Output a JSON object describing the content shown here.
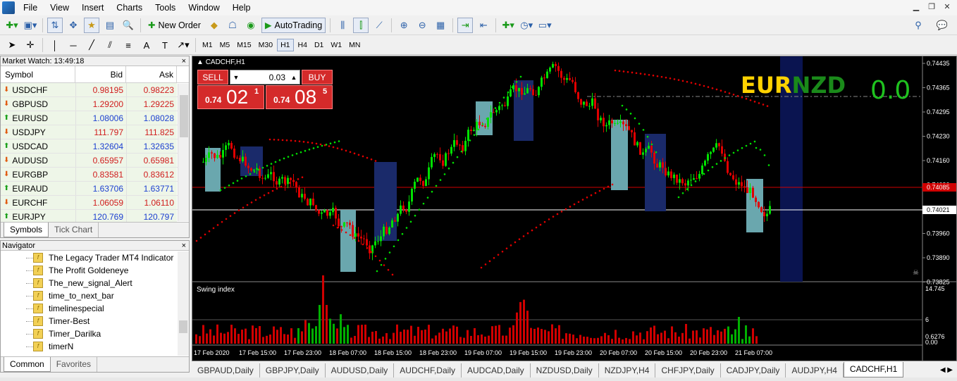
{
  "menu": [
    "File",
    "View",
    "Insert",
    "Charts",
    "Tools",
    "Window",
    "Help"
  ],
  "toolbar": {
    "new_order": "New Order",
    "auto_trading": "AutoTrading"
  },
  "timeframes": [
    "M1",
    "M5",
    "M15",
    "M30",
    "H1",
    "H4",
    "D1",
    "W1",
    "MN"
  ],
  "active_timeframe": "H1",
  "market_watch": {
    "title": "Market Watch: 13:49:18",
    "columns": [
      "Symbol",
      "Bid",
      "Ask"
    ],
    "rows": [
      {
        "symbol": "USDCHF",
        "bid": "0.98195",
        "ask": "0.98223",
        "dir": "down",
        "color": "#d01c1c"
      },
      {
        "symbol": "GBPUSD",
        "bid": "1.29200",
        "ask": "1.29225",
        "dir": "down",
        "color": "#d01c1c"
      },
      {
        "symbol": "EURUSD",
        "bid": "1.08006",
        "ask": "1.08028",
        "dir": "up",
        "color": "#1c3fd0"
      },
      {
        "symbol": "USDJPY",
        "bid": "111.797",
        "ask": "111.825",
        "dir": "down",
        "color": "#d01c1c"
      },
      {
        "symbol": "USDCAD",
        "bid": "1.32604",
        "ask": "1.32635",
        "dir": "up",
        "color": "#1c3fd0"
      },
      {
        "symbol": "AUDUSD",
        "bid": "0.65957",
        "ask": "0.65981",
        "dir": "down",
        "color": "#d01c1c"
      },
      {
        "symbol": "EURGBP",
        "bid": "0.83581",
        "ask": "0.83612",
        "dir": "down",
        "color": "#d01c1c"
      },
      {
        "symbol": "EURAUD",
        "bid": "1.63706",
        "ask": "1.63771",
        "dir": "up",
        "color": "#1c3fd0"
      },
      {
        "symbol": "EURCHF",
        "bid": "1.06059",
        "ask": "1.06110",
        "dir": "down",
        "color": "#d01c1c"
      },
      {
        "symbol": "EURJPY",
        "bid": "120.769",
        "ask": "120.797",
        "dir": "up",
        "color": "#1c3fd0"
      }
    ],
    "tabs": [
      "Symbols",
      "Tick Chart"
    ]
  },
  "navigator": {
    "title": "Navigator",
    "items": [
      "The Legacy Trader MT4 Indicator",
      "The Profit Goldeneye",
      "The_new_signal_Alert",
      "time_to_next_bar",
      "timelinespecial",
      "Timer-Best",
      "Timer_Darilka",
      "timerN"
    ],
    "tabs": [
      "Common",
      "Favorites"
    ]
  },
  "chart": {
    "symbol_label": "CADCHF,H1",
    "sell_label": "SELL",
    "buy_label": "BUY",
    "lot": "0.03",
    "sell_prefix": "0.74",
    "sell_big": "02",
    "sell_sup": "1",
    "buy_prefix": "0.74",
    "buy_big": "08",
    "buy_sup": "5",
    "overlay_a": "EUR",
    "overlay_b": "NZD",
    "overlay_value": "0.0",
    "indicator_label": "Swing index",
    "price_ticks": [
      "0.74435",
      "0.74365",
      "0.74295",
      "0.74230",
      "0.74160",
      "0.74090",
      "0.74021",
      "0.73960",
      "0.73890",
      "0.73825"
    ],
    "red_price_label": "0.74085",
    "white_price_label": "0.74021",
    "indicator_ticks": [
      "14.745",
      "6",
      "0.6276",
      "0.00"
    ],
    "time_ticks": [
      "17 Feb 2020",
      "17 Feb 15:00",
      "17 Feb 23:00",
      "18 Feb 07:00",
      "18 Feb 15:00",
      "18 Feb 23:00",
      "19 Feb 07:00",
      "19 Feb 15:00",
      "19 Feb 23:00",
      "20 Feb 07:00",
      "20 Feb 15:00",
      "20 Feb 23:00",
      "21 Feb 07:00"
    ]
  },
  "chart_tabs": [
    "GBPAUD,Daily",
    "GBPJPY,Daily",
    "AUDUSD,Daily",
    "AUDCHF,Daily",
    "AUDCAD,Daily",
    "NZDUSD,Daily",
    "NZDJPY,H4",
    "CHFJPY,Daily",
    "CADJPY,Daily",
    "AUDJPY,H4",
    "CADCHF,H1"
  ],
  "active_chart_tab": "CADCHF,H1",
  "colors": {
    "bull": "#00e000",
    "bear": "#e00000",
    "sell_bg": "#d42a2a",
    "eur": "#ffd200",
    "nzd": "#1a8a1a",
    "zero": "#1fc21f"
  }
}
